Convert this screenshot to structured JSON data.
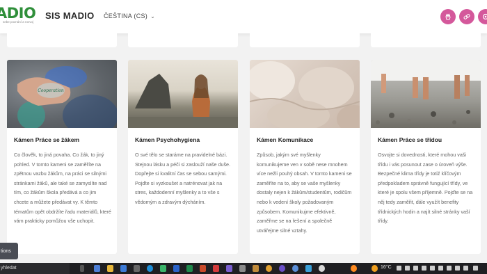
{
  "header": {
    "logo_text": "ADIO",
    "logo_subtitle": "sebe poznání a rozvoj",
    "site_name": "SIS MADIO",
    "language": "ČEŠTINA (CS)"
  },
  "cards": [
    {
      "title": "Kámen Práce se žákem",
      "image_text": "Cooperation",
      "description": "Co člověk, to jiná povaha. Co žák, to jiný pohled. V tomto kameni se zaměříte na zpětnou vazbu žákům, na práci se silnými stránkami žáků, ale také se zamyslíte nad tím, co žákům škola předává a co jim chcete a můžete předávat vy. K těmto tématům opět obdržíte řadu materiálů, které vám prakticky pomůžou vše uchopit."
    },
    {
      "title": "Kámen Psychohygiena",
      "description": "O své tělo se staráme na pravidelné bázi. Stejnou lásku a péči si zaslouží naše duše. Dopřejte si kvalitní čas se sebou samými. Pojďte si vyzkoušet a natrénovat jak na stres, každodenní myšlenky a to vše s vědomým a zdravým dýcháním."
    },
    {
      "title": "Kámen Komunikace",
      "description": "Způsob, jakým své myšlenky komunikujeme ven v sobě nese mnohem více nežli pouhý obsah. V tomto kameni se zaměříte na to, aby se vaše myšlenky dostaly nejen k žákům/studentům, rodičům nebo k vedení školy požadovaným způsobem. Komunikujme efektivně, zaměřme se na řešení a společně utvářejme silné vztahy."
    },
    {
      "title": "Kámen Práce se třídou",
      "description": "Osvojte si dovednosti, které mohou vaši třídu i vás posunout zase o úroveň výše. Bezpečné klima třídy je totiž klíčovým předpokladem správně fungující třídy, ve které je spolu všem příjemně. Pojďte se na něj tedy zaměřit, dále využít benefity třídnických hodin a najít silné stránky vaší třídy."
    }
  ],
  "side_button": "tions",
  "taskbar": {
    "search_text": "yhledat",
    "temperature": "16°C"
  },
  "colors": {
    "brand_green": "#2f8f3a",
    "accent_pink": "#d4589b",
    "taskbar": "#1f1f22"
  },
  "icons": {
    "header_buttons": [
      "hand-icon",
      "link-icon",
      "settings-icon"
    ]
  }
}
